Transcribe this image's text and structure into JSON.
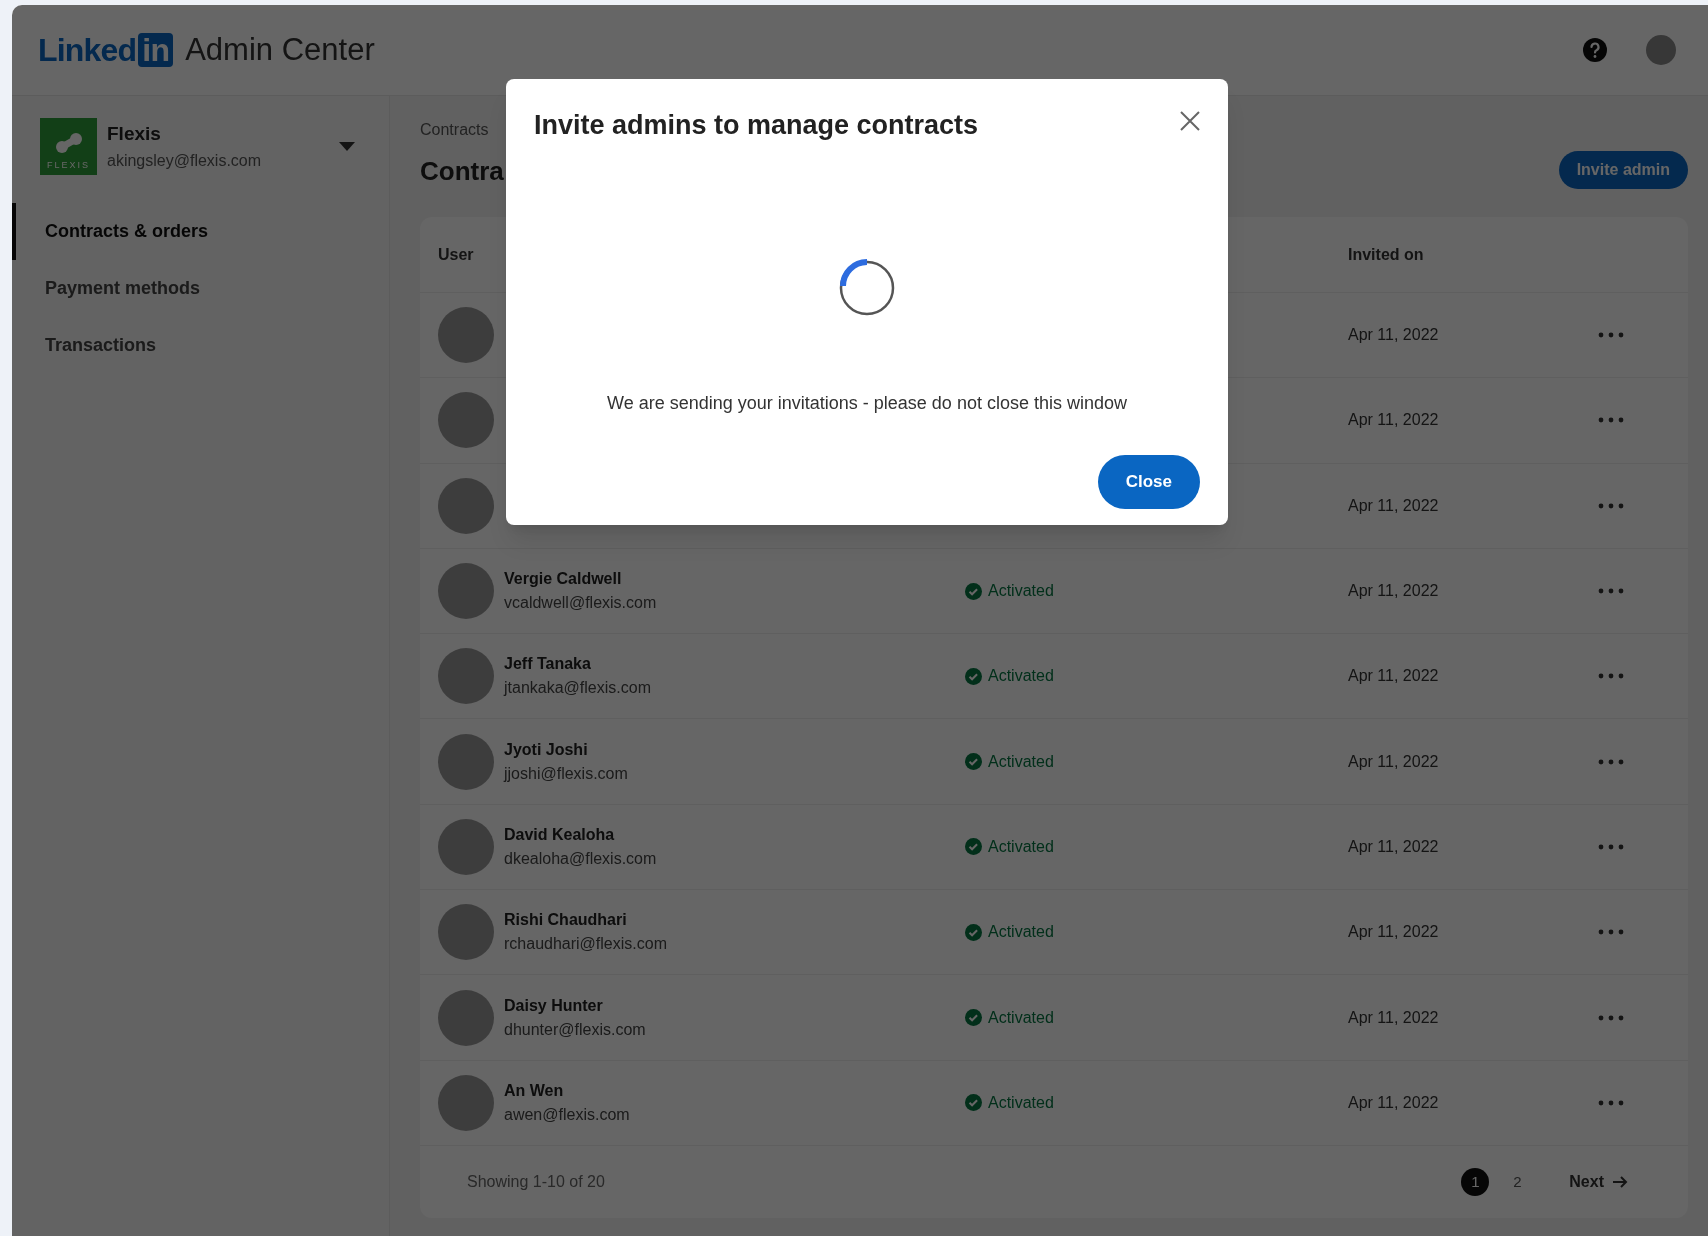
{
  "header": {
    "logo_word": "Linked",
    "logo_badge": "in",
    "product": "Admin Center"
  },
  "account": {
    "logo_text": "FLEXIS",
    "name": "Flexis",
    "email": "akingsley@flexis.com"
  },
  "nav": [
    {
      "label": "Contracts & orders",
      "selected": true
    },
    {
      "label": "Payment methods",
      "selected": false
    },
    {
      "label": "Transactions",
      "selected": false
    }
  ],
  "breadcrumb": "Contracts",
  "page_title": "Contra",
  "invite_button": "Invite admin",
  "table": {
    "columns": [
      "User",
      "Invited on"
    ],
    "rows": [
      {
        "date": "Apr 11, 2022"
      },
      {
        "date": "Apr 11, 2022"
      },
      {
        "date": "Apr 11, 2022"
      },
      {
        "name": "Vergie Caldwell",
        "email": "vcaldwell@flexis.com",
        "status": "Activated",
        "date": "Apr 11, 2022"
      },
      {
        "name": "Jeff Tanaka",
        "email": "jtankaka@flexis.com",
        "status": "Activated",
        "date": "Apr 11, 2022"
      },
      {
        "name": "Jyoti Joshi",
        "email": "jjoshi@flexis.com",
        "status": "Activated",
        "date": "Apr 11, 2022"
      },
      {
        "name": "David Kealoha",
        "email": "dkealoha@flexis.com",
        "status": "Activated",
        "date": "Apr 11, 2022"
      },
      {
        "name": "Rishi Chaudhari",
        "email": "rchaudhari@flexis.com",
        "status": "Activated",
        "date": "Apr 11, 2022"
      },
      {
        "name": "Daisy Hunter",
        "email": "dhunter@flexis.com",
        "status": "Activated",
        "date": "Apr 11, 2022"
      },
      {
        "name": "An Wen",
        "email": "awen@flexis.com",
        "status": "Activated",
        "date": "Apr 11, 2022"
      }
    ]
  },
  "footer": {
    "showing": "Showing 1-10 of 20",
    "pages": [
      {
        "label": "1",
        "selected": true
      },
      {
        "label": "2",
        "selected": false
      }
    ],
    "next": "Next"
  },
  "dialog": {
    "title": "Invite admins to manage contracts",
    "message": "We are sending your invitations - please do not close this window",
    "button": "Close"
  }
}
